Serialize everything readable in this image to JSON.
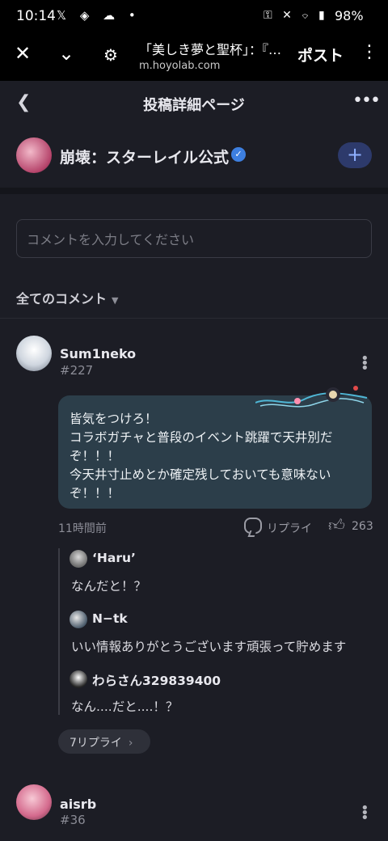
{
  "status_bar": {
    "time": "10:14",
    "battery": "98%"
  },
  "browser": {
    "page_title": "「美しき夢と聖杯」：『…",
    "url": "m.hoyolab.com",
    "post_label": "ポスト"
  },
  "header": {
    "title": "投稿詳細ページ"
  },
  "account": {
    "name": "崩壊：スターレイル公式"
  },
  "comment_input": {
    "placeholder": "コメントを入力してください"
  },
  "sort": {
    "label": "全てのコメント"
  },
  "comments": [
    {
      "user": "Sum1neko",
      "floor": "#227",
      "text_lines": [
        "皆気をつけろ！",
        "コラボガチャと普段のイベント跳躍で天井別だ",
        "ぞ！！！",
        "今天井寸止めとか確定残しておいても意味ない",
        "ぞ！！！"
      ],
      "time": "11時間前",
      "reply_label": "リプライ",
      "likes": "263",
      "replies": [
        {
          "user": "‘Haru’",
          "text": "なんだと！？"
        },
        {
          "user": "N−tk",
          "text": "いい情報ありがとうございます頑張って貯めます"
        },
        {
          "user": "わらさん329839400",
          "text": "なん....だと....！？"
        }
      ],
      "more_replies_label": "7リプライ"
    },
    {
      "user": "aisrb",
      "floor": "#36"
    }
  ],
  "colors": {
    "background": "#1c1d25",
    "bubble": "#2c3e4a",
    "follow_button": "#2d3a6b",
    "verified_badge": "#3d7fe0"
  }
}
